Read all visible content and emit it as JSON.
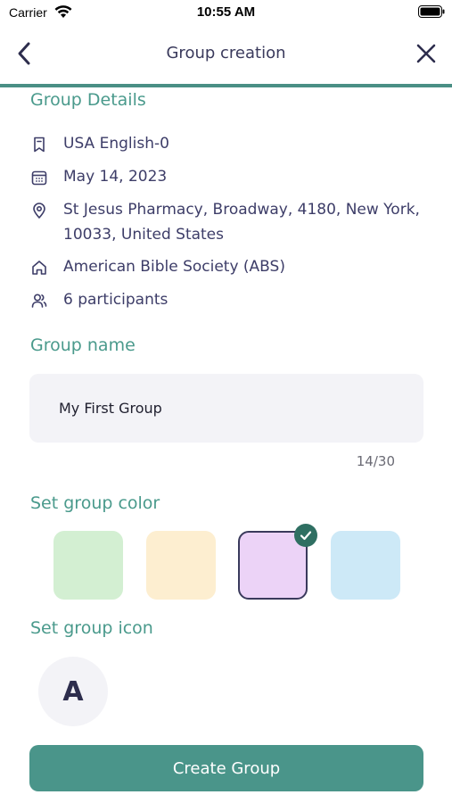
{
  "status_bar": {
    "carrier": "Carrier",
    "time": "10:55 AM",
    "icons": [
      "wifi-icon",
      "battery-icon"
    ]
  },
  "nav": {
    "title": "Group creation",
    "back_icon": "chevron-left-icon",
    "close_icon": "close-icon"
  },
  "details": {
    "title": "Group Details",
    "items": [
      {
        "icon": "bookmark-icon",
        "text": "USA English-0"
      },
      {
        "icon": "calendar-icon",
        "text": "May 14, 2023"
      },
      {
        "icon": "location-pin-icon",
        "text": "St Jesus Pharmacy, Broadway, 4180, New York, 10033, United States"
      },
      {
        "icon": "home-icon",
        "text": "American Bible Society (ABS)"
      },
      {
        "icon": "users-icon",
        "text": "6 participants"
      }
    ]
  },
  "group_name": {
    "label": "Group name",
    "value": "My First Group",
    "count": "14/30"
  },
  "group_color": {
    "label": "Set group color",
    "swatches": [
      "#d3efd2",
      "#fdeed0",
      "#ecd3f7",
      "#cde9f7"
    ],
    "selected_index": 2,
    "accent": "#2f6f62"
  },
  "group_icon": {
    "label": "Set group icon",
    "letter": "A"
  },
  "create_button": {
    "label": "Create Group",
    "color": "#4a958a"
  }
}
